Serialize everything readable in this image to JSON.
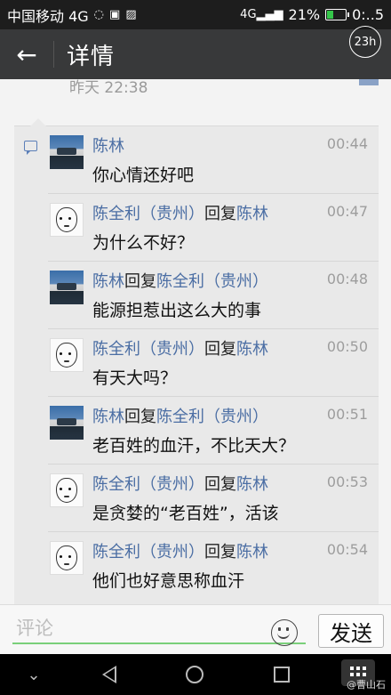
{
  "status_bar": {
    "carrier": "中国移动 4G",
    "battery": "21%",
    "time": "0:..5"
  },
  "title_bar": {
    "title": "详情",
    "timer_badge": "23h"
  },
  "post": {
    "time": "昨天 22:38"
  },
  "comments": [
    {
      "author": "陈林",
      "reply_word": "",
      "reply_to": "",
      "time": "00:44",
      "text": "你心情还好吧",
      "avatar": "landscape"
    },
    {
      "author": "陈全利（贵州）",
      "reply_word": "回复",
      "reply_to": "陈林",
      "time": "00:47",
      "text": "为什么不好？",
      "avatar": "face-sketch"
    },
    {
      "author": "陈林",
      "reply_word": "回复",
      "reply_to": "陈全利（贵州）",
      "time": "00:48",
      "text": "能源担惹出这么大的事",
      "avatar": "landscape"
    },
    {
      "author": "陈全利（贵州）",
      "reply_word": "回复",
      "reply_to": "陈林",
      "time": "00:50",
      "text": "有天大吗？",
      "avatar": "face-sketch"
    },
    {
      "author": "陈林",
      "reply_word": "回复",
      "reply_to": "陈全利（贵州）",
      "time": "00:51",
      "text": "老百姓的血汗，不比天大？",
      "avatar": "landscape"
    },
    {
      "author": "陈全利（贵州）",
      "reply_word": "回复",
      "reply_to": "陈林",
      "time": "00:53",
      "text": "是贪婪的“老百姓”，活该",
      "avatar": "face-sketch"
    },
    {
      "author": "陈全利（贵州）",
      "reply_word": "回复",
      "reply_to": "陈林",
      "time": "00:54",
      "text": "他们也好意思称血汗",
      "avatar": "face-sketch"
    }
  ],
  "input_bar": {
    "placeholder": "评论",
    "send_label": "发送"
  },
  "watermark": "@曹山石",
  "colors": {
    "name_blue": "#4b6ea4",
    "title_bar_bg": "#38393a",
    "input_accent": "#7ad07a"
  }
}
